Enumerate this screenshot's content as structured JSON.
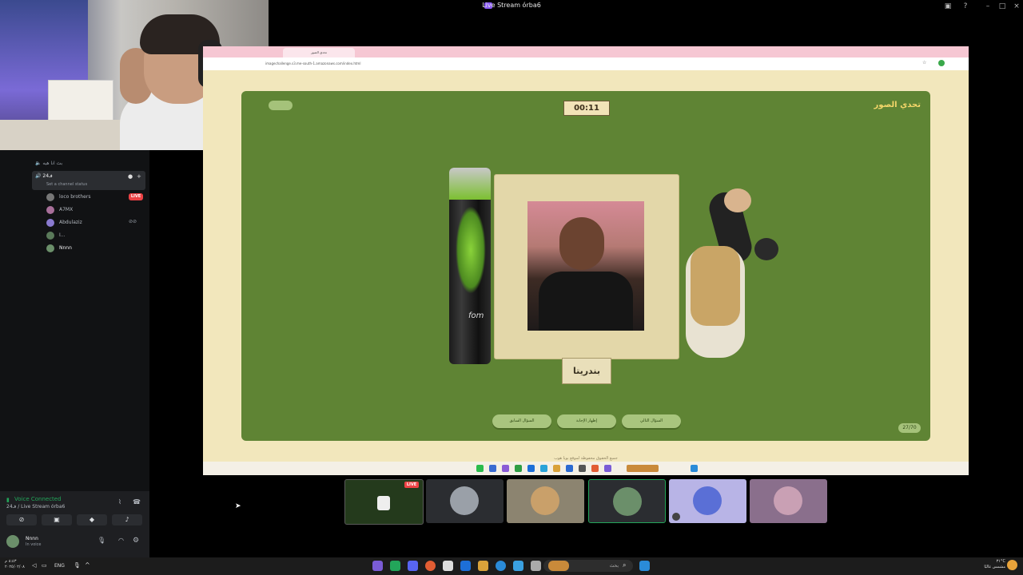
{
  "window": {
    "title": "Live Stream órba6"
  },
  "sidebar": {
    "channels": [
      {
        "name": "بث انا هيه"
      },
      {
        "name": "24فـ",
        "status": "Set a channel status"
      }
    ],
    "users": [
      {
        "name": "loco brothers",
        "live": "LIVE"
      },
      {
        "name": "A7MX"
      },
      {
        "name": "Abdulaziz"
      },
      {
        "name": "I..."
      },
      {
        "name": "Nnnn"
      }
    ],
    "voice": {
      "connected": "Voice Connected",
      "channel": "24فـ / Live Stream órba6"
    },
    "user": {
      "name": "Nnnn",
      "status": "In voice"
    }
  },
  "browser": {
    "tab": "تحدي الصور",
    "url": "imagechallenge.s3.me-south-1.amazonaws.com/index.html"
  },
  "game": {
    "title": "تحدي الصور",
    "timer": "00:11",
    "can_text": "fom",
    "answer": "بندريتا",
    "buttons": {
      "prev": "السؤال السابق",
      "show": "إظهار الإجابة",
      "next": "السؤال التالي"
    },
    "counter": "27/70",
    "footer": "جميع الحقوق محفوظة لموقع بوبا هوب"
  },
  "stream_tiles": {
    "live": "LIVE"
  },
  "taskbar": {
    "time": "٨:٤٣ م",
    "date": "٢٠٢٥/٠٢/٠٨",
    "lang": "ENG",
    "search": "بحث",
    "weather_temp": "٣١°C",
    "weather_desc": "مشمس غالبًا"
  },
  "colors": {
    "game_bg": "#5f8434",
    "page_bg": "#f2e7bc",
    "title_gold": "#f4d66a",
    "live_red": "#ed4245",
    "voice_green": "#23a55a"
  }
}
